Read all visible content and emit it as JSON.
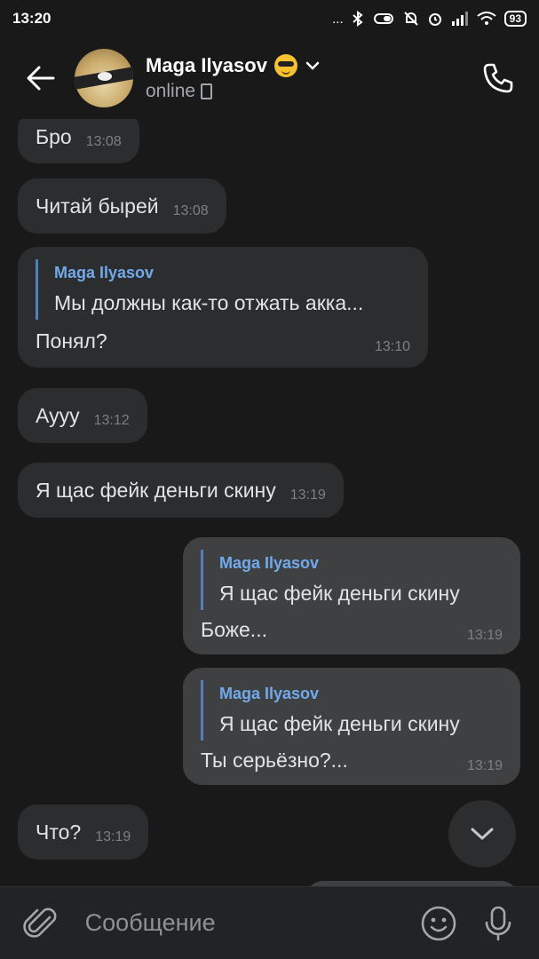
{
  "statusbar": {
    "time": "13:20",
    "dots": "...",
    "battery": "93"
  },
  "header": {
    "name": "Maga Ilyasov",
    "status": "online"
  },
  "messages": [
    {
      "text": "Бро",
      "time": "13:08"
    },
    {
      "text": "Читай бырей",
      "time": "13:08"
    },
    {
      "reply_author": "Maga Ilyasov",
      "reply_text": "Мы должны как-то отжать акка...",
      "text": "Понял?",
      "time": "13:10"
    },
    {
      "text": "Аууу",
      "time": "13:12"
    },
    {
      "text": "Я щас фейк деньги скину",
      "time": "13:19"
    },
    {
      "reply_author": "Maga Ilyasov",
      "reply_text": "Я щас фейк деньги скину",
      "text": "Боже...",
      "time": "13:19"
    },
    {
      "reply_author": "Maga Ilyasov",
      "reply_text": "Я щас фейк деньги скину",
      "text": "Ты серьёзно?...",
      "time": "13:19"
    },
    {
      "text": "Что?",
      "time": "13:19"
    }
  ],
  "composer": {
    "placeholder": "Сообщение"
  },
  "icons": {
    "back": "arrow-left-icon",
    "call": "phone-icon",
    "scroll": "chevron-down-icon",
    "attach": "paperclip-icon",
    "emoji": "smile-icon",
    "mic": "microphone-icon"
  },
  "colors": {
    "background": "#19191a",
    "incoming": "#2c2d2e",
    "outgoing": "#3f4042",
    "accent": "#71aaeb"
  }
}
